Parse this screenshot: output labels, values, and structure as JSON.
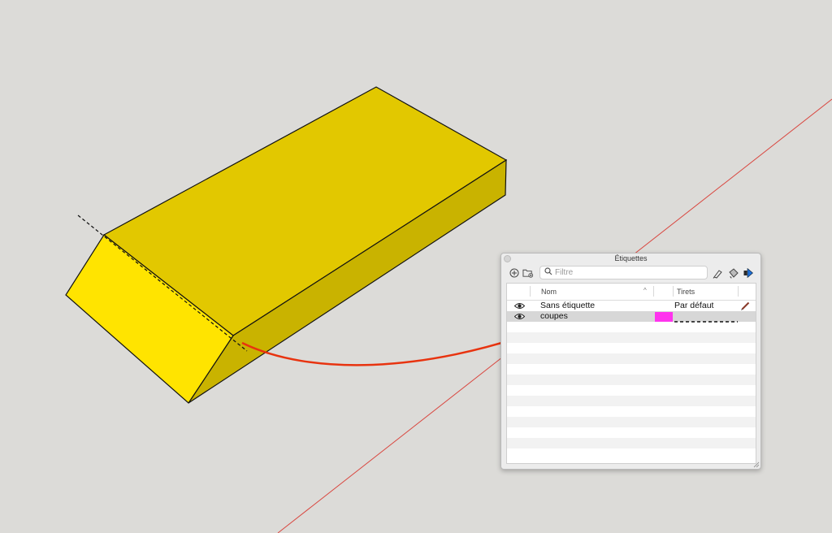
{
  "panel": {
    "title": "Étiquettes",
    "search_placeholder": "Filtre",
    "headers": {
      "name": "Nom",
      "dashes": "Tirets"
    },
    "rows": [
      {
        "name": "Sans étiquette",
        "dashes": "Par défaut",
        "visible": true,
        "color": "",
        "edit_icon": "pencil-icon"
      },
      {
        "name": "coupes",
        "dashes": "",
        "visible": true,
        "color": "#ff33ee",
        "line_style": "dashed",
        "selected": true
      }
    ]
  },
  "toolbar_icons": [
    "add-tag-icon",
    "add-folder-icon",
    "search-icon",
    "tag-tool-icon",
    "tag-bucket-icon",
    "details-arrow-icon"
  ],
  "colors": {
    "background": "#dcdbd8",
    "box_top": "#e2c800",
    "box_front": "#ffe400",
    "box_side": "#c9b300",
    "axis_red": "#d9463f",
    "arrow": "#e8330f"
  }
}
